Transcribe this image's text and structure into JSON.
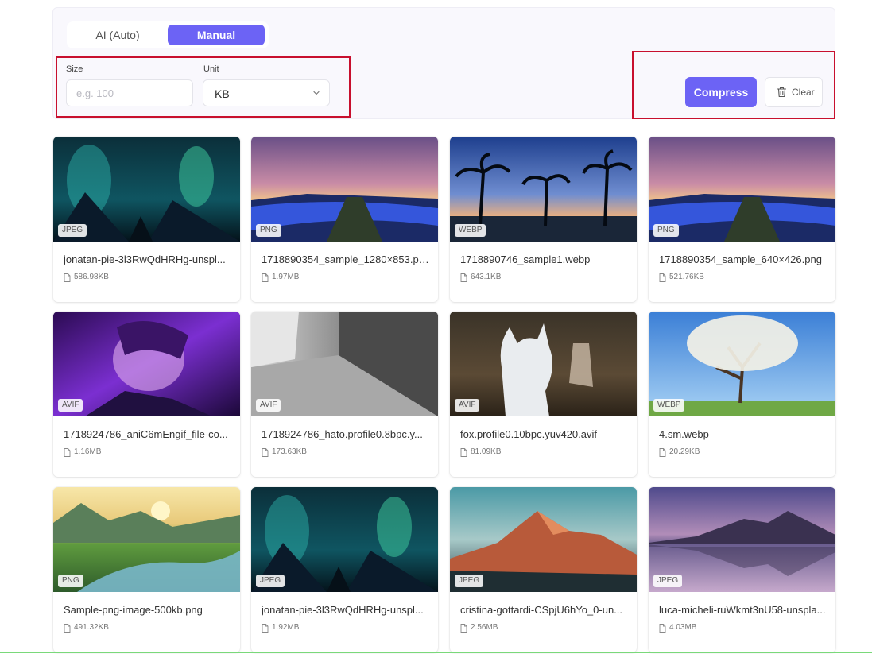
{
  "mode_toggle": {
    "auto_label": "AI (Auto)",
    "manual_label": "Manual",
    "selected": "Manual"
  },
  "size_field": {
    "label": "Size",
    "placeholder": "e.g. 100",
    "value": ""
  },
  "unit_field": {
    "label": "Unit",
    "value": "KB"
  },
  "actions": {
    "compress_label": "Compress",
    "clear_label": "Clear"
  },
  "accent_color": "#6c63f5",
  "highlight_color": "#c8102e",
  "images": [
    {
      "name": "jonatan-pie-3l3RwQdHRHg-unspl...",
      "size": "586.98KB",
      "format": "JPEG"
    },
    {
      "name": "1718890354_sample_1280×853.png",
      "size": "1.97MB",
      "format": "PNG"
    },
    {
      "name": "1718890746_sample1.webp",
      "size": "643.1KB",
      "format": "WEBP"
    },
    {
      "name": "1718890354_sample_640×426.png",
      "size": "521.76KB",
      "format": "PNG"
    },
    {
      "name": "1718924786_aniC6mEngif_file-co...",
      "size": "1.16MB",
      "format": "AVIF"
    },
    {
      "name": "1718924786_hato.profile0.8bpc.y...",
      "size": "173.63KB",
      "format": "AVIF"
    },
    {
      "name": "fox.profile0.10bpc.yuv420.avif",
      "size": "81.09KB",
      "format": "AVIF"
    },
    {
      "name": "4.sm.webp",
      "size": "20.29KB",
      "format": "WEBP"
    },
    {
      "name": "Sample-png-image-500kb.png",
      "size": "491.32KB",
      "format": "PNG"
    },
    {
      "name": "jonatan-pie-3l3RwQdHRHg-unspl...",
      "size": "1.92MB",
      "format": "JPEG"
    },
    {
      "name": "cristina-gottardi-CSpjU6hYo_0-un...",
      "size": "2.56MB",
      "format": "JPEG"
    },
    {
      "name": "luca-micheli-ruWkmt3nU58-unspla...",
      "size": "4.03MB",
      "format": "JPEG"
    }
  ]
}
